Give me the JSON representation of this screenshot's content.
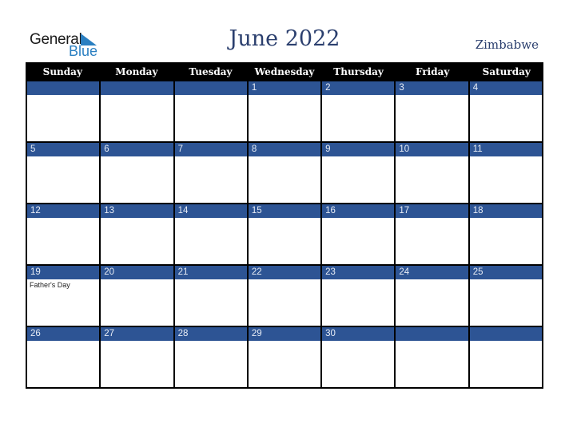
{
  "logo": {
    "general": "General",
    "blue": "Blue",
    "icon": "triangle-flag-icon",
    "color": "#2a7fc1"
  },
  "title": "June 2022",
  "country": "Zimbabwe",
  "colors": {
    "header_bg": "#000000",
    "band_bg": "#2d5494",
    "title": "#2b3f6e"
  },
  "weekdays": [
    "Sunday",
    "Monday",
    "Tuesday",
    "Wednesday",
    "Thursday",
    "Friday",
    "Saturday"
  ],
  "weeks": [
    [
      {
        "day": ""
      },
      {
        "day": ""
      },
      {
        "day": ""
      },
      {
        "day": "1"
      },
      {
        "day": "2"
      },
      {
        "day": "3"
      },
      {
        "day": "4"
      }
    ],
    [
      {
        "day": "5"
      },
      {
        "day": "6"
      },
      {
        "day": "7"
      },
      {
        "day": "8"
      },
      {
        "day": "9"
      },
      {
        "day": "10"
      },
      {
        "day": "11"
      }
    ],
    [
      {
        "day": "12"
      },
      {
        "day": "13"
      },
      {
        "day": "14"
      },
      {
        "day": "15"
      },
      {
        "day": "16"
      },
      {
        "day": "17"
      },
      {
        "day": "18"
      }
    ],
    [
      {
        "day": "19",
        "event": "Father's Day"
      },
      {
        "day": "20"
      },
      {
        "day": "21"
      },
      {
        "day": "22"
      },
      {
        "day": "23"
      },
      {
        "day": "24"
      },
      {
        "day": "25"
      }
    ],
    [
      {
        "day": "26"
      },
      {
        "day": "27"
      },
      {
        "day": "28"
      },
      {
        "day": "29"
      },
      {
        "day": "30"
      },
      {
        "day": ""
      },
      {
        "day": ""
      }
    ]
  ]
}
